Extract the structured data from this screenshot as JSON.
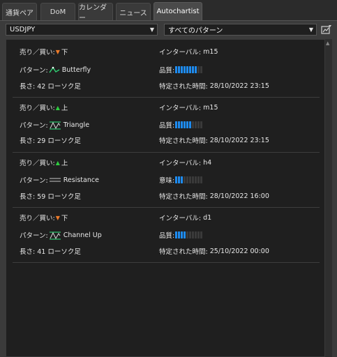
{
  "tabs": [
    {
      "label": "通貨ペア",
      "active": false
    },
    {
      "label": "DoM",
      "active": false
    },
    {
      "label": "カレンダー",
      "active": false
    },
    {
      "label": "ニュース",
      "active": false
    },
    {
      "label": "Autochartist",
      "active": true
    }
  ],
  "symbol_select": {
    "value": "USDJPY"
  },
  "pattern_select": {
    "value": "すべてのパターン"
  },
  "labels": {
    "direction": "売り／買い:",
    "pattern": "パターン:",
    "length": "長さ:",
    "interval": "インターバル:",
    "identified": "特定された時間:"
  },
  "colors": {
    "bar_on": "#1e8bef",
    "bar_off": "#3a3a3a",
    "up": "#2ecc40",
    "down": "#f07c2a"
  },
  "results": [
    {
      "direction": "下",
      "direction_icon": "down-arrow",
      "pattern": "Butterfly",
      "pattern_icon": "butterfly-icon",
      "length": "42 ローソク足",
      "interval": "m15",
      "quality_label": "品質:",
      "quality_level": 8,
      "quality_max": 10,
      "identified": "28/10/2022 23:15"
    },
    {
      "direction": "上",
      "direction_icon": "up-arrow",
      "pattern": "Triangle",
      "pattern_icon": "triangle-icon",
      "length": "29 ローソク足",
      "interval": "m15",
      "quality_label": "品質:",
      "quality_level": 6,
      "quality_max": 10,
      "identified": "28/10/2022 23:15"
    },
    {
      "direction": "上",
      "direction_icon": "up-arrow",
      "pattern": "Resistance",
      "pattern_icon": "resistance-icon",
      "length": "59 ローソク足",
      "interval": "h4",
      "quality_label": "意味:",
      "quality_level": 3,
      "quality_max": 10,
      "identified": "28/10/2022 16:00"
    },
    {
      "direction": "下",
      "direction_icon": "down-arrow",
      "pattern": "Channel Up",
      "pattern_icon": "channel-up-icon",
      "length": "41 ローソク足",
      "interval": "d1",
      "quality_label": "品質:",
      "quality_level": 4,
      "quality_max": 10,
      "identified": "25/10/2022 00:00"
    }
  ]
}
